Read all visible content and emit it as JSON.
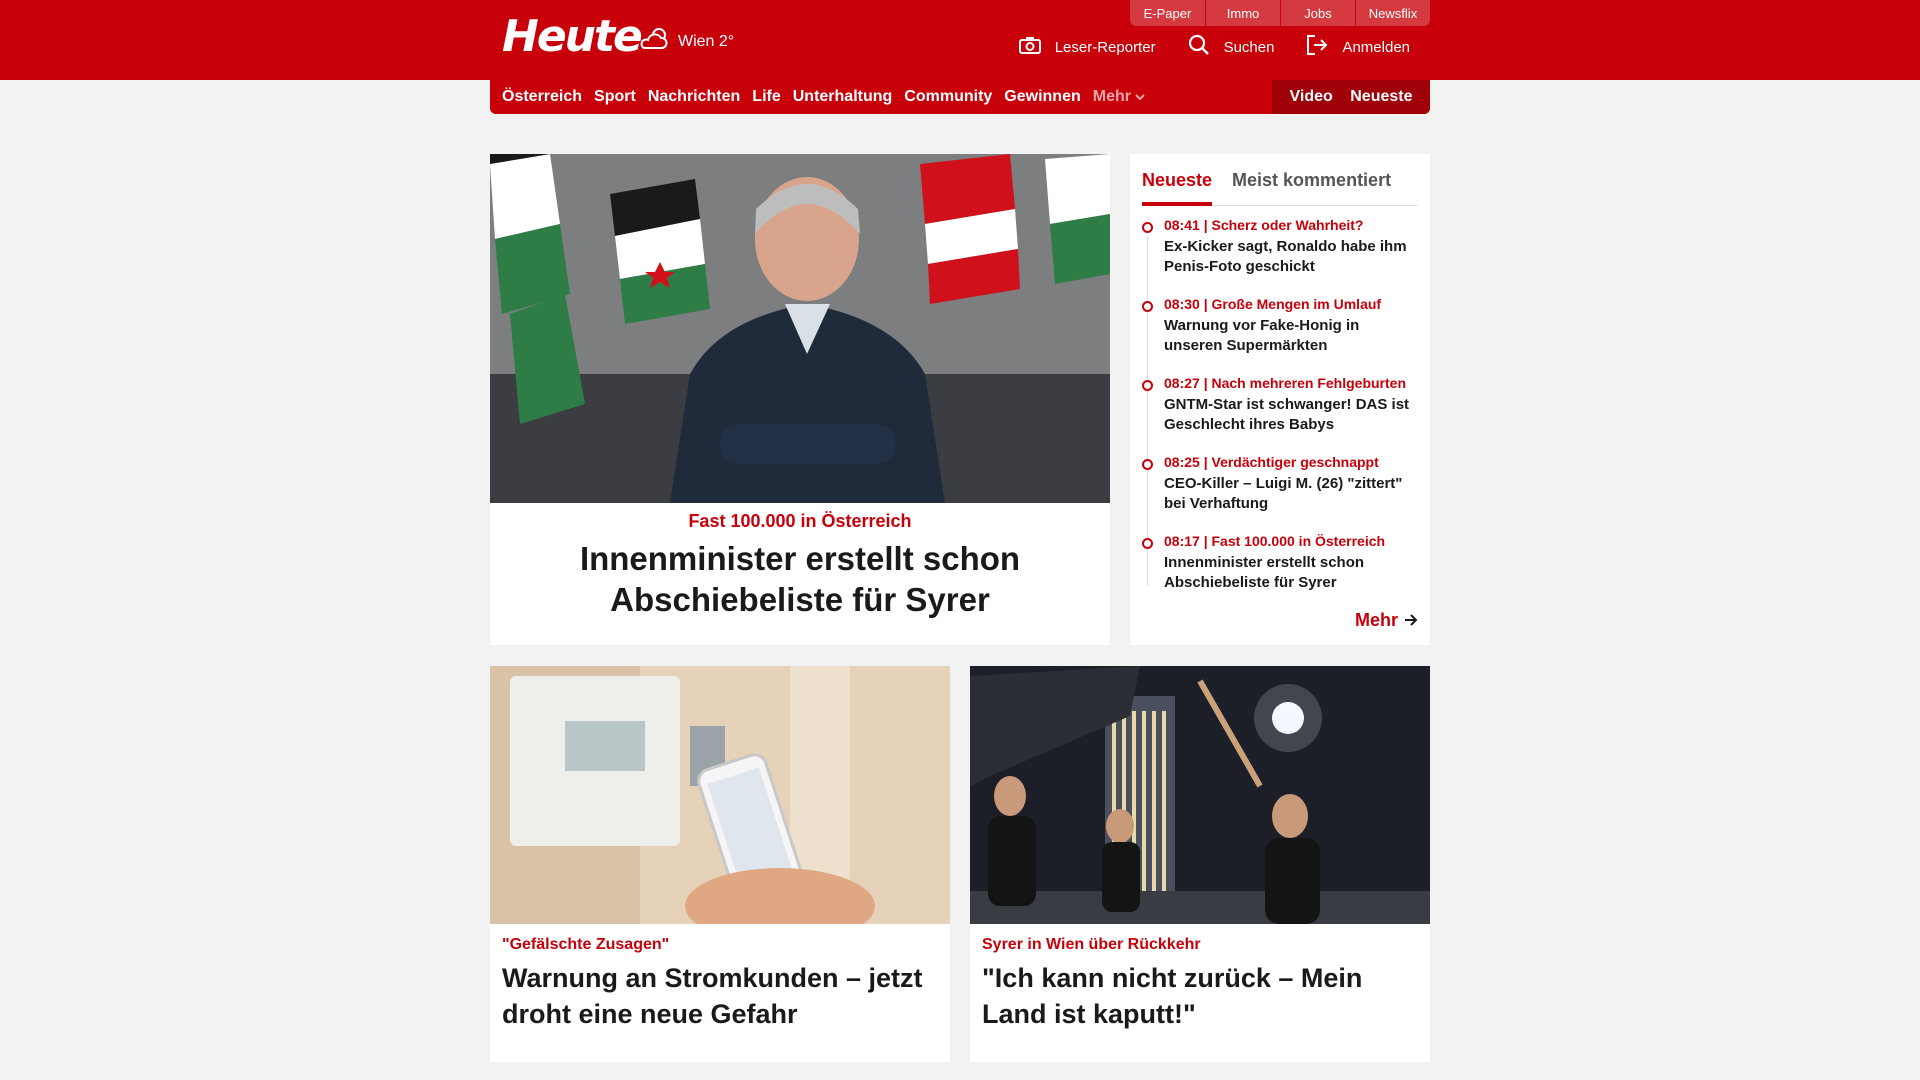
{
  "header": {
    "logo": "Heute",
    "weather": "Wien 2°",
    "top_links": [
      "E-Paper",
      "Immo",
      "Jobs",
      "Newsflix"
    ],
    "tools": {
      "reporter": "Leser-Reporter",
      "search": "Suchen",
      "login": "Anmelden"
    }
  },
  "nav": {
    "items": [
      "Österreich",
      "Sport",
      "Nachrichten",
      "Life",
      "Unterhaltung",
      "Community",
      "Gewinnen"
    ],
    "more": "Mehr",
    "right": [
      "Video",
      "Neueste"
    ]
  },
  "hero": {
    "kicker": "Fast 100.000 in Österreich",
    "title_line1": "Innenminister erstellt schon",
    "title_line2": "Abschiebeliste für Syrer"
  },
  "sidebar": {
    "tabs": [
      "Neueste",
      "Meist kommentiert"
    ],
    "items": [
      {
        "meta": "08:41 | Scherz oder Wahrheit?",
        "title": "Ex-Kicker sagt, Ronaldo habe ihm Penis-Foto geschickt"
      },
      {
        "meta": "08:30 | Große Mengen im Umlauf",
        "title": "Warnung vor Fake-Honig in unseren Supermärkten"
      },
      {
        "meta": "08:27 | Nach mehreren Fehlgeburten",
        "title": "GNTM-Star ist schwanger! DAS ist Geschlecht ihres Babys"
      },
      {
        "meta": "08:25 | Verdächtiger geschnappt",
        "title": "CEO-Killer – Luigi M. (26) \"zittert\" bei Verhaftung"
      },
      {
        "meta": "08:17 | Fast 100.000 in Österreich",
        "title": "Innenminister erstellt schon Abschiebeliste für Syrer"
      }
    ],
    "more": "Mehr"
  },
  "cards": [
    {
      "kicker": "\"Gefälschte Zusagen\"",
      "title": "Warnung an Stromkunden – jetzt droht eine neue Gefahr"
    },
    {
      "kicker": "Syrer in Wien über Rückkehr",
      "title": "\"Ich kann nicht zurück – Mein Land ist kaputt!\""
    }
  ]
}
